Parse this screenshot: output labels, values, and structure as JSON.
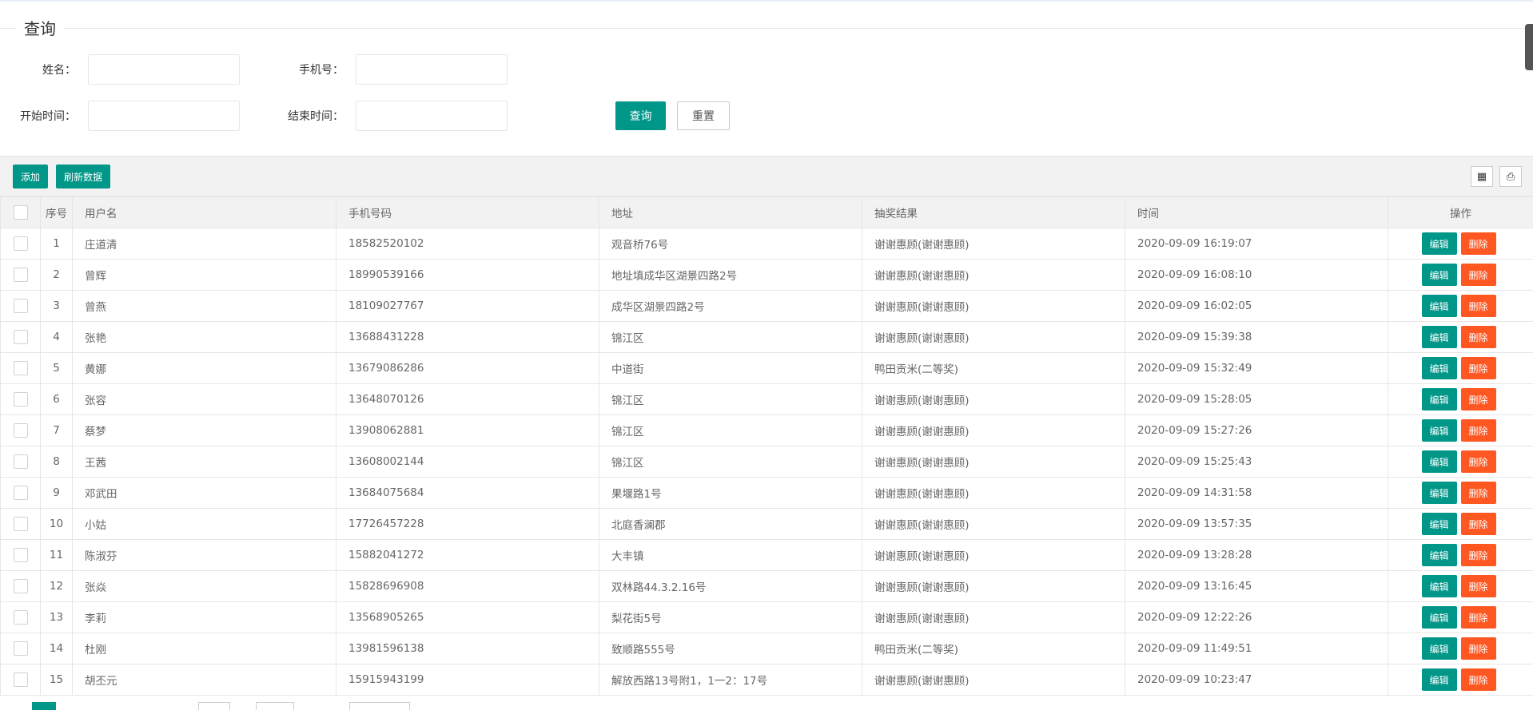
{
  "search": {
    "legend": "查询",
    "name_label": "姓名：",
    "phone_label": "手机号：",
    "start_label": "开始时间：",
    "end_label": "结束时间：",
    "query_button": "查询",
    "reset_button": "重置"
  },
  "toolbar": {
    "add_button": "添加",
    "refresh_button": "刷新数据",
    "columns_icon": "columns-icon",
    "print_icon": "print-icon"
  },
  "table": {
    "columns": [
      "序号",
      "用户名",
      "手机号码",
      "地址",
      "抽奖结果",
      "时间",
      "操作"
    ],
    "edit_label": "编辑",
    "delete_label": "删除",
    "rows": [
      {
        "no": "1",
        "name": "庄道清",
        "phone": "18582520102",
        "address": "观音桥76号",
        "result": "谢谢惠顾(谢谢惠顾)",
        "time": "2020-09-09 16:19:07"
      },
      {
        "no": "2",
        "name": "曾辉",
        "phone": "18990539166",
        "address": "地址填成华区湖景四路2号",
        "result": "谢谢惠顾(谢谢惠顾)",
        "time": "2020-09-09 16:08:10"
      },
      {
        "no": "3",
        "name": "曾燕",
        "phone": "18109027767",
        "address": "成华区湖景四路2号",
        "result": "谢谢惠顾(谢谢惠顾)",
        "time": "2020-09-09 16:02:05"
      },
      {
        "no": "4",
        "name": "张艳",
        "phone": "13688431228",
        "address": "锦江区",
        "result": "谢谢惠顾(谢谢惠顾)",
        "time": "2020-09-09 15:39:38"
      },
      {
        "no": "5",
        "name": "黄娜",
        "phone": "13679086286",
        "address": "中道街",
        "result": "鸭田贡米(二等奖)",
        "time": "2020-09-09 15:32:49"
      },
      {
        "no": "6",
        "name": "张容",
        "phone": "13648070126",
        "address": "锦江区",
        "result": "谢谢惠顾(谢谢惠顾)",
        "time": "2020-09-09 15:28:05"
      },
      {
        "no": "7",
        "name": "蔡梦",
        "phone": "13908062881",
        "address": "锦江区",
        "result": "谢谢惠顾(谢谢惠顾)",
        "time": "2020-09-09 15:27:26"
      },
      {
        "no": "8",
        "name": "王茜",
        "phone": "13608002144",
        "address": "锦江区",
        "result": "谢谢惠顾(谢谢惠顾)",
        "time": "2020-09-09 15:25:43"
      },
      {
        "no": "9",
        "name": "邓武田",
        "phone": "13684075684",
        "address": "果堰路1号",
        "result": "谢谢惠顾(谢谢惠顾)",
        "time": "2020-09-09 14:31:58"
      },
      {
        "no": "10",
        "name": "小姑",
        "phone": "17726457228",
        "address": "北庭香澜郡",
        "result": "谢谢惠顾(谢谢惠顾)",
        "time": "2020-09-09 13:57:35"
      },
      {
        "no": "11",
        "name": "陈淑芬",
        "phone": "15882041272",
        "address": "大丰镇",
        "result": "谢谢惠顾(谢谢惠顾)",
        "time": "2020-09-09 13:28:28"
      },
      {
        "no": "12",
        "name": "张焱",
        "phone": "15828696908",
        "address": "双林路44.3.2.16号",
        "result": "谢谢惠顾(谢谢惠顾)",
        "time": "2020-09-09 13:16:45"
      },
      {
        "no": "13",
        "name": "李莉",
        "phone": "13568905265",
        "address": "梨花街5号",
        "result": "谢谢惠顾(谢谢惠顾)",
        "time": "2020-09-09 12:22:26"
      },
      {
        "no": "14",
        "name": "杜刚",
        "phone": "13981596138",
        "address": "致顺路555号",
        "result": "鸭田贡米(二等奖)",
        "time": "2020-09-09 11:49:51"
      },
      {
        "no": "15",
        "name": "胡丕元",
        "phone": "15915943199",
        "address": "解放西路13号附1，1一2：17号",
        "result": "谢谢惠顾(谢谢惠顾)",
        "time": "2020-09-09 10:23:47"
      }
    ]
  },
  "colors": {
    "primary": "#009688",
    "danger": "#FF5722",
    "header_bg": "#f2f2f2",
    "border": "#e6e6e6"
  }
}
